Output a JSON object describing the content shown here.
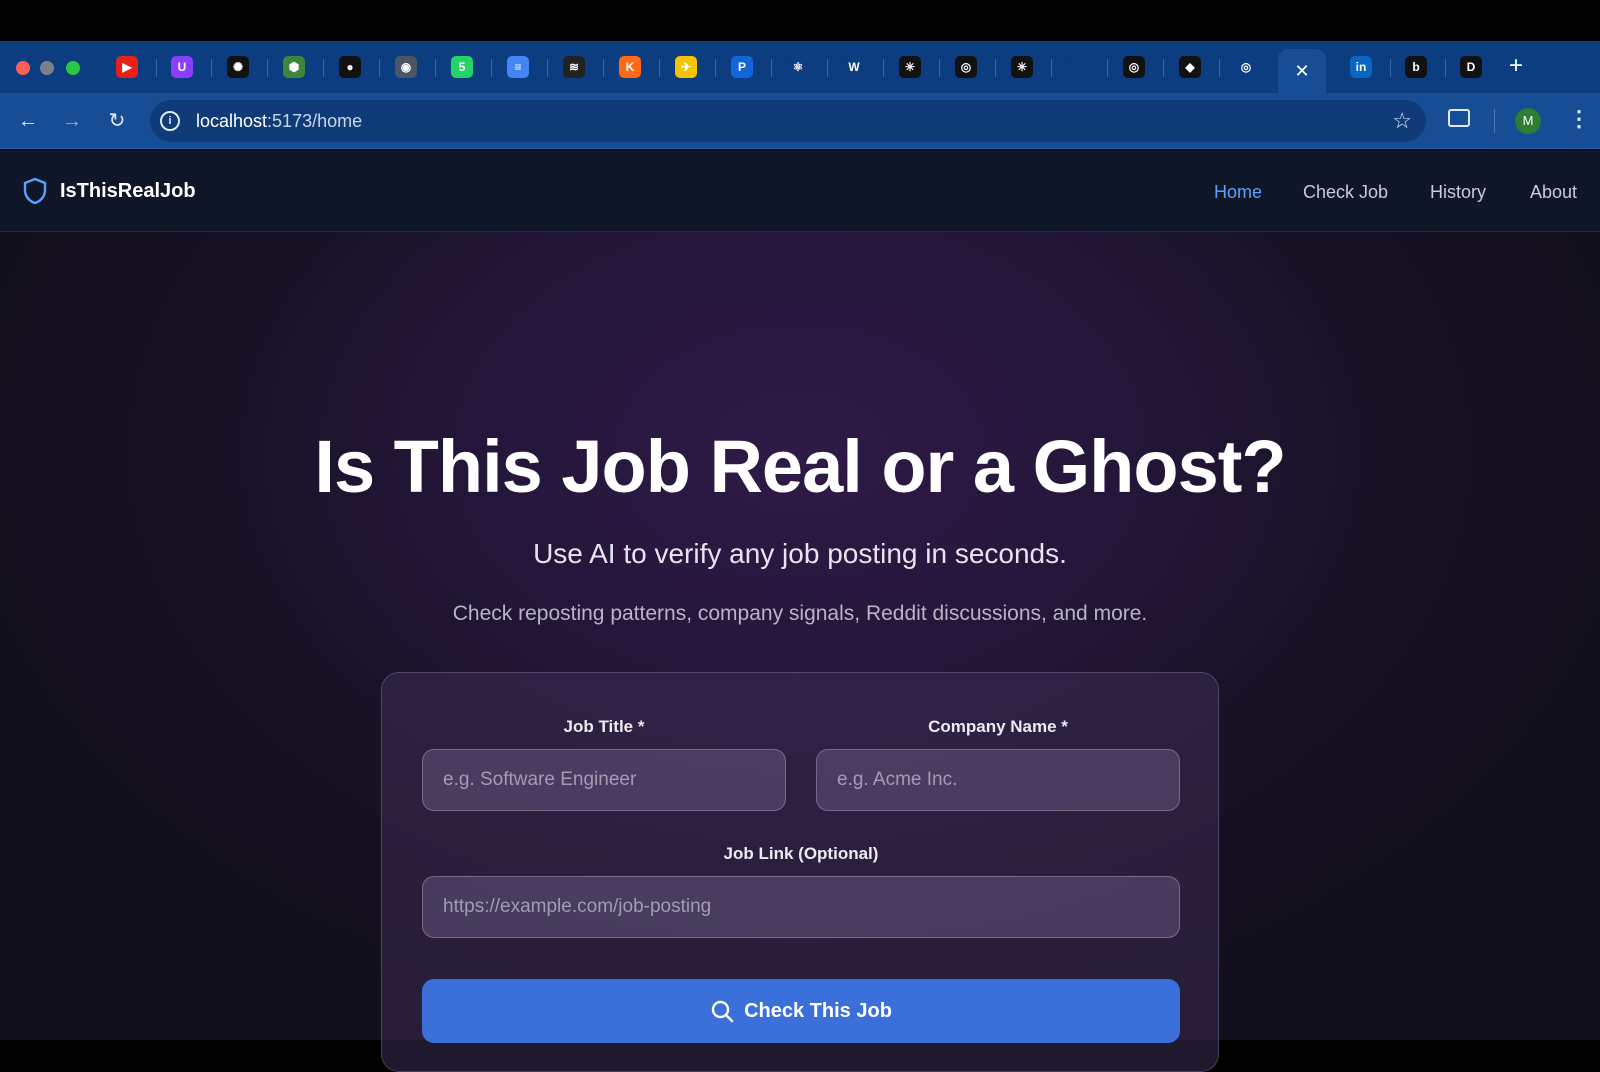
{
  "browser": {
    "url_host": "localhost",
    "url_path": ":5173/home",
    "avatar_initial": "M",
    "new_tab_symbol": "+",
    "close_tab_symbol": "✕",
    "tabs": [
      {
        "icon": "youtube-icon",
        "glyph": "▶",
        "color": "#e62117"
      },
      {
        "icon": "u-icon",
        "glyph": "U",
        "color": "#8a3ffc"
      },
      {
        "icon": "openai-icon",
        "glyph": "✺",
        "color": "#111111"
      },
      {
        "icon": "nodejs-icon",
        "glyph": "⬢",
        "color": "#3c873a"
      },
      {
        "icon": "github-icon",
        "glyph": "●",
        "color": "#111111"
      },
      {
        "icon": "globe-icon",
        "glyph": "◉",
        "color": "#4a5566"
      },
      {
        "icon": "whatsapp-icon",
        "glyph": "5",
        "color": "#25d366"
      },
      {
        "icon": "docs-icon",
        "glyph": "≡",
        "color": "#4285f4"
      },
      {
        "icon": "stackoverflow-icon",
        "glyph": "≋",
        "color": "#222222"
      },
      {
        "icon": "k-icon",
        "glyph": "K",
        "color": "#ff6a13"
      },
      {
        "icon": "flight-icon",
        "glyph": "✈",
        "color": "#f5c400"
      },
      {
        "icon": "p-icon",
        "glyph": "P",
        "color": "#1167d8"
      },
      {
        "icon": "react-icon",
        "glyph": "⚛",
        "color": "#0b3d80"
      },
      {
        "icon": "w-icon",
        "glyph": "W",
        "color": "#0b3d80"
      },
      {
        "icon": "perplexity-icon",
        "glyph": "✳",
        "color": "#111111"
      },
      {
        "icon": "circle-icon",
        "glyph": "◎",
        "color": "#111111"
      },
      {
        "icon": "perplexity-icon",
        "glyph": "✳",
        "color": "#111111"
      },
      {
        "icon": "blank-icon",
        "glyph": "",
        "color": "#0b3d80"
      },
      {
        "icon": "circle-icon",
        "glyph": "◎",
        "color": "#111111"
      },
      {
        "icon": "cursor-icon",
        "glyph": "◆",
        "color": "#111111"
      },
      {
        "icon": "chrome-icon",
        "glyph": "◎",
        "color": "#0b3d80"
      },
      {
        "icon": "linkedin-icon",
        "glyph": "in",
        "color": "#0a66c2"
      },
      {
        "icon": "b-icon",
        "glyph": "b",
        "color": "#111111"
      },
      {
        "icon": "d-icon",
        "glyph": "D",
        "color": "#111111"
      }
    ]
  },
  "app": {
    "brand": "IsThisRealJob",
    "nav": [
      {
        "label": "Home",
        "active": true
      },
      {
        "label": "Check Job",
        "active": false
      },
      {
        "label": "History",
        "active": false
      },
      {
        "label": "About",
        "active": false
      }
    ]
  },
  "hero": {
    "title": "Is This Job Real or a Ghost?",
    "subtitle": "Use AI to verify any job posting in seconds.",
    "description": "Check reposting patterns, company signals, Reddit discussions, and more."
  },
  "form": {
    "job_title_label": "Job Title *",
    "job_title_placeholder": "e.g. Software Engineer",
    "company_label": "Company Name *",
    "company_placeholder": "e.g. Acme Inc.",
    "link_label": "Job Link (Optional)",
    "link_placeholder": "https://example.com/job-posting",
    "submit_label": "Check This Job"
  }
}
